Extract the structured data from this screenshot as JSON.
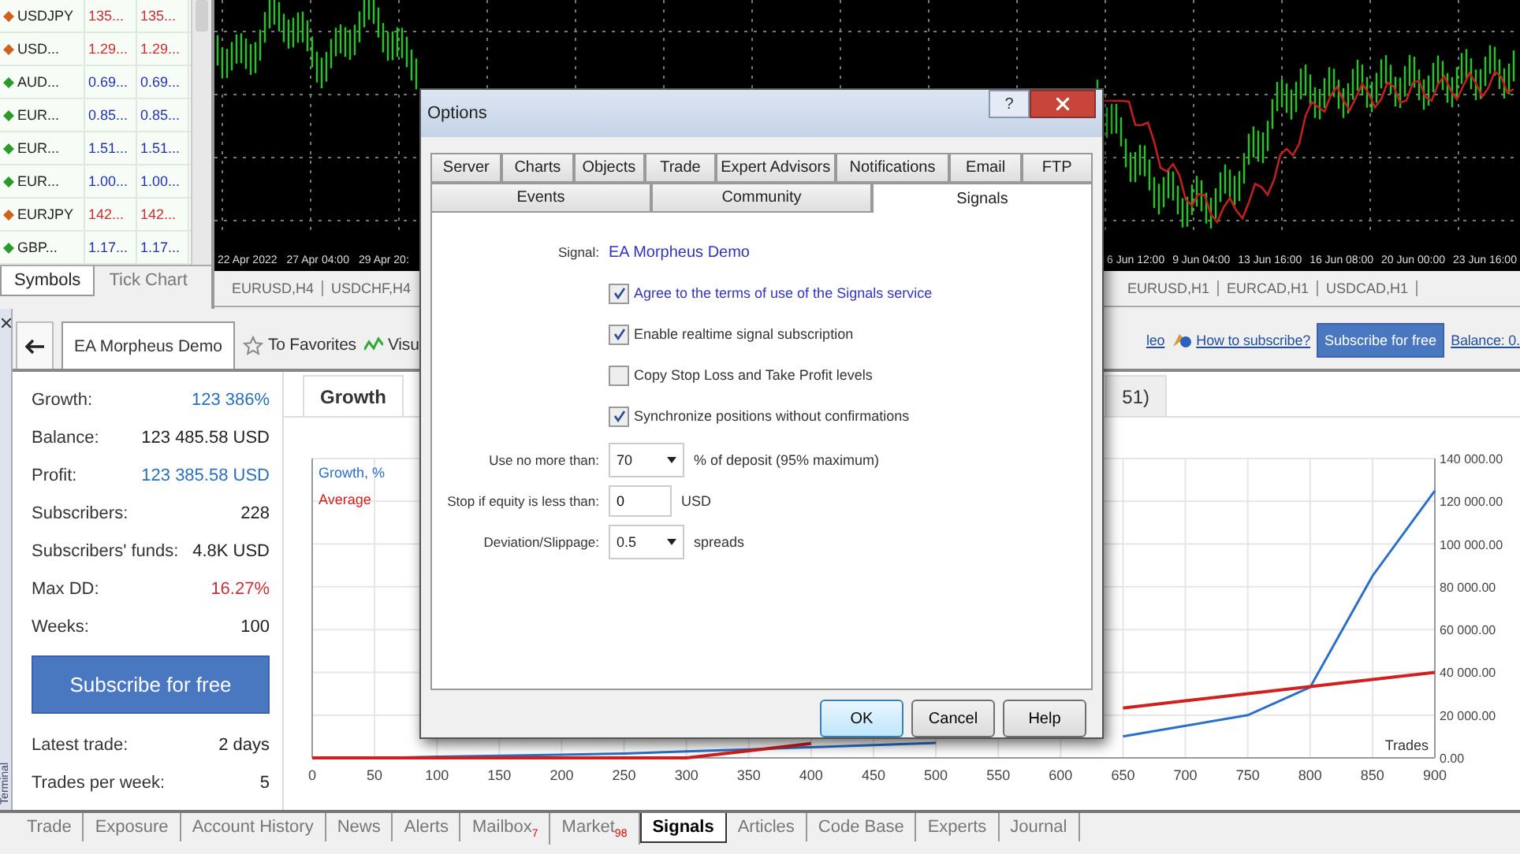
{
  "market_watch": {
    "rows": [
      {
        "symbol": "USDJPY",
        "bid": "135...",
        "ask": "135...",
        "rising": false
      },
      {
        "symbol": "USD...",
        "bid": "1.29...",
        "ask": "1.29...",
        "rising": false
      },
      {
        "symbol": "AUD...",
        "bid": "0.69...",
        "ask": "0.69...",
        "rising": true
      },
      {
        "symbol": "EUR...",
        "bid": "0.85...",
        "ask": "0.85...",
        "rising": true
      },
      {
        "symbol": "EUR...",
        "bid": "1.51...",
        "ask": "1.51...",
        "rising": true
      },
      {
        "symbol": "EUR...",
        "bid": "1.00...",
        "ask": "1.00...",
        "rising": true
      },
      {
        "symbol": "EURJPY",
        "bid": "142...",
        "ask": "142...",
        "rising": false
      },
      {
        "symbol": "GBP...",
        "bid": "1.17...",
        "ask": "1.17...",
        "rising": true
      }
    ],
    "tabs": [
      {
        "label": "Symbols",
        "selected": true
      },
      {
        "label": "Tick Chart",
        "selected": false
      }
    ]
  },
  "price_chart": {
    "time_labels_left": [
      "22 Apr 2022",
      "27 Apr 04:00",
      "29 Apr 20:"
    ],
    "time_labels_right": [
      "6 Jun 12:00",
      "9 Jun 04:00",
      "13 Jun 16:00",
      "16 Jun 08:00",
      "20 Jun 00:00",
      "23 Jun 16:00"
    ],
    "tabs_left": [
      "EURUSD,H4",
      "USDCHF,H4"
    ],
    "tabs_right": [
      "EURUSD,H1",
      "EURCAD,H1",
      "USDCAD,H1"
    ]
  },
  "terminal": {
    "side_label": "Terminal"
  },
  "signal_toolbar": {
    "tab": "EA Morpheus Demo",
    "favorites": "To Favorites",
    "visual": "Visu",
    "help_fragment": "leo",
    "how_to": "How to subscribe?",
    "subscribe": "Subscribe for free",
    "balance": "Balance: 0."
  },
  "stats": [
    {
      "label": "Growth:",
      "value": "123 386%",
      "color": "#2a6fb8"
    },
    {
      "label": "Balance:",
      "value": "123 485.58 USD",
      "color": "#222222"
    },
    {
      "label": "Profit:",
      "value": "123 385.58 USD",
      "color": "#2a6fb8"
    },
    {
      "label": "Subscribers:",
      "value": "228",
      "color": "#222222"
    },
    {
      "label": "Subscribers' funds:",
      "value": "4.8K USD",
      "color": "#222222"
    },
    {
      "label": "Max DD:",
      "value": "16.27%",
      "color": "#c8303a"
    },
    {
      "label": "Weeks:",
      "value": "100",
      "color": "#222222"
    }
  ],
  "stats_button": "Subscribe for free",
  "stats_after": [
    {
      "label": "Latest trade:",
      "value": "2 days",
      "color": "#222222"
    },
    {
      "label": "Trades per week:",
      "value": "5",
      "color": "#222222"
    }
  ],
  "growth_panel": {
    "tabs": [
      {
        "label": "Growth",
        "selected": true
      },
      {
        "label": "51)",
        "selected": false
      }
    ],
    "chart_data": {
      "type": "line",
      "xlabel": "Trades",
      "grid": true,
      "x": [
        0,
        50,
        100,
        150,
        200,
        250,
        300,
        350,
        400,
        450,
        500,
        550,
        600,
        650,
        700,
        750,
        800,
        850,
        900
      ],
      "series": [
        {
          "name": "Growth, %",
          "color": "#2a6fc8",
          "values": [
            0,
            0,
            500,
            1000,
            1500,
            2000,
            3000,
            4000,
            5000,
            6000,
            7000,
            null,
            null,
            10000,
            15000,
            20000,
            33000,
            85000,
            125000
          ]
        },
        {
          "name": "Average",
          "color": "#d02020",
          "values": [
            0,
            0,
            0,
            0,
            0,
            0,
            0,
            3300,
            6700,
            null,
            null,
            null,
            null,
            23300,
            26700,
            30000,
            33300,
            36700,
            40000
          ]
        }
      ],
      "xlim": [
        0,
        900
      ],
      "ylim": [
        0,
        140000
      ],
      "xticks": [
        0,
        50,
        100,
        150,
        200,
        250,
        300,
        350,
        400,
        450,
        500,
        550,
        600,
        650,
        700,
        750,
        800,
        850,
        900
      ],
      "yticks": [
        {
          "value": 0,
          "label": "0.00"
        },
        {
          "value": 20000,
          "label": "20 000.00"
        },
        {
          "value": 40000,
          "label": "40 000.00"
        },
        {
          "value": 60000,
          "label": "60 000.00"
        },
        {
          "value": 80000,
          "label": "80 000.00"
        },
        {
          "value": 100000,
          "label": "100 000.00"
        },
        {
          "value": 120000,
          "label": "120 000.00"
        },
        {
          "value": 140000,
          "label": "140 000.00"
        }
      ]
    }
  },
  "bottom_tabs": [
    {
      "label": "Trade",
      "selected": false
    },
    {
      "label": "Exposure",
      "selected": false
    },
    {
      "label": "Account History",
      "selected": false
    },
    {
      "label": "News",
      "selected": false
    },
    {
      "label": "Alerts",
      "selected": false
    },
    {
      "label": "Mailbox",
      "badge": "7",
      "selected": false
    },
    {
      "label": "Market",
      "badge": "98",
      "selected": false
    },
    {
      "label": "Signals",
      "selected": true
    },
    {
      "label": "Articles",
      "selected": false
    },
    {
      "label": "Code Base",
      "selected": false
    },
    {
      "label": "Experts",
      "selected": false
    },
    {
      "label": "Journal",
      "selected": false
    }
  ],
  "dialog": {
    "title": "Options",
    "help": "?",
    "tabs_row1": [
      {
        "label": "Server",
        "selected": false
      },
      {
        "label": "Charts",
        "selected": false
      },
      {
        "label": "Objects",
        "selected": false
      },
      {
        "label": "Trade",
        "selected": false
      },
      {
        "label": "Expert Advisors",
        "selected": false
      },
      {
        "label": "Notifications",
        "selected": false
      },
      {
        "label": "Email",
        "selected": false
      },
      {
        "label": "FTP",
        "selected": false
      }
    ],
    "tabs_row2": [
      {
        "label": "Events",
        "selected": false
      },
      {
        "label": "Community",
        "selected": false
      },
      {
        "label": "Signals",
        "selected": true
      }
    ],
    "signal_label": "Signal:",
    "signal_name": "EA Morpheus Demo",
    "checkboxes": [
      {
        "label": "Agree to the terms of use of the Signals service",
        "checked": true,
        "kind": "link"
      },
      {
        "label": "Enable realtime signal subscription",
        "checked": true,
        "kind": "plain"
      },
      {
        "label": "Copy Stop Loss and Take Profit levels",
        "checked": false,
        "kind": "plain"
      },
      {
        "label": "Synchronize positions without confirmations",
        "checked": true,
        "kind": "plain"
      }
    ],
    "fields": [
      {
        "kind": "select",
        "label": "Use no more than:",
        "value": "70",
        "suffix": "% of deposit (95% maximum)"
      },
      {
        "kind": "input",
        "label": "Stop if equity is less than:",
        "value": "0",
        "suffix": "USD"
      },
      {
        "kind": "select",
        "label": "Deviation/Slippage:",
        "value": "0.5",
        "suffix": "spreads"
      }
    ],
    "buttons": [
      {
        "label": "OK",
        "default": true
      },
      {
        "label": "Cancel",
        "default": false
      },
      {
        "label": "Help",
        "default": false
      }
    ]
  }
}
